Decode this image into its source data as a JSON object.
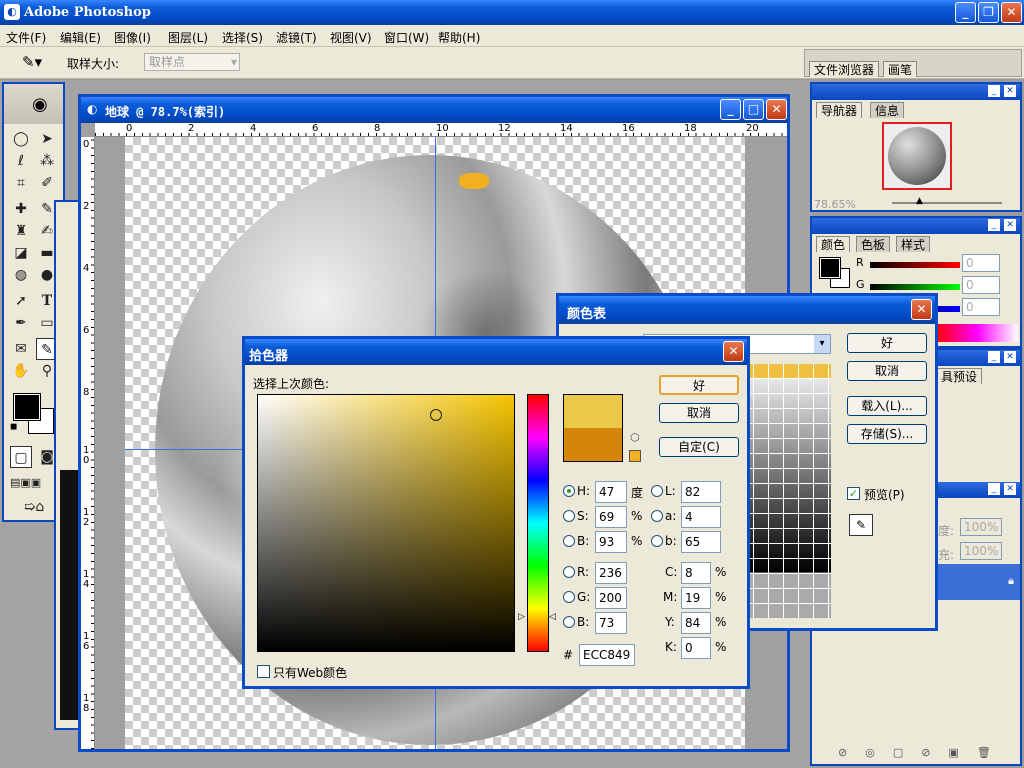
{
  "app": {
    "title": "Adobe Photoshop"
  },
  "menu": [
    "文件(F)",
    "编辑(E)",
    "图像(I)",
    "图层(L)",
    "选择(S)",
    "滤镜(T)",
    "视图(V)",
    "窗口(W)",
    "帮助(H)"
  ],
  "options": {
    "sample_size_label": "取样大小:",
    "sample_size_value": "取样点"
  },
  "palette_well": {
    "tabs": [
      "文件浏览器",
      "画笔"
    ]
  },
  "document": {
    "title": "地球 @ 78.7%(索引)",
    "ruler_top": [
      "0",
      "2",
      "4",
      "6",
      "8",
      "10",
      "12",
      "14",
      "16",
      "18",
      "20"
    ],
    "ruler_left": [
      "0",
      "2",
      "4",
      "6",
      "8",
      "1",
      "0",
      "1",
      "2",
      "1",
      "4",
      "1",
      "6",
      "1",
      "8"
    ]
  },
  "navigator": {
    "tabs": [
      "导航器",
      "信息"
    ],
    "zoom": "78.65%"
  },
  "color_panel": {
    "tabs": [
      "颜色",
      "色板",
      "样式"
    ],
    "r_label": "R",
    "g_label": "G",
    "b_label": "B",
    "r": "0",
    "g": "0",
    "b": "0"
  },
  "layers_panel": {
    "partial_tab": "具预设",
    "opacity_label": "度:",
    "opacity": "100%",
    "fill_label": "充:",
    "fill": "100%"
  },
  "color_table": {
    "title": "颜色表",
    "ok": "好",
    "cancel": "取消",
    "load": "载入(L)...",
    "save": "存储(S)...",
    "preview": "预览(P)"
  },
  "picker": {
    "title": "拾色器",
    "select_label": "选择上次颜色:",
    "ok": "好",
    "cancel": "取消",
    "custom": "自定(C)",
    "h_label": "H:",
    "h": "47",
    "h_unit": "度",
    "s_label": "S:",
    "s": "69",
    "s_unit": "%",
    "bri_label": "B:",
    "bri": "93",
    "bri_unit": "%",
    "r_label": "R:",
    "r": "236",
    "g_label": "G:",
    "g": "200",
    "b_label": "B:",
    "b": "73",
    "l_label": "L:",
    "l": "82",
    "a_label": "a:",
    "a": "4",
    "lb_label": "b:",
    "lb": "65",
    "c_label": "C:",
    "c": "8",
    "c_unit": "%",
    "m_label": "M:",
    "m": "19",
    "m_unit": "%",
    "y_label": "Y:",
    "y": "84",
    "y_unit": "%",
    "k_label": "K:",
    "k": "0",
    "k_unit": "%",
    "hex_label": "#",
    "hex": "ECC849",
    "web_only": "只有Web颜色",
    "new_color": "#ecc849",
    "old_color": "#d4860a"
  }
}
